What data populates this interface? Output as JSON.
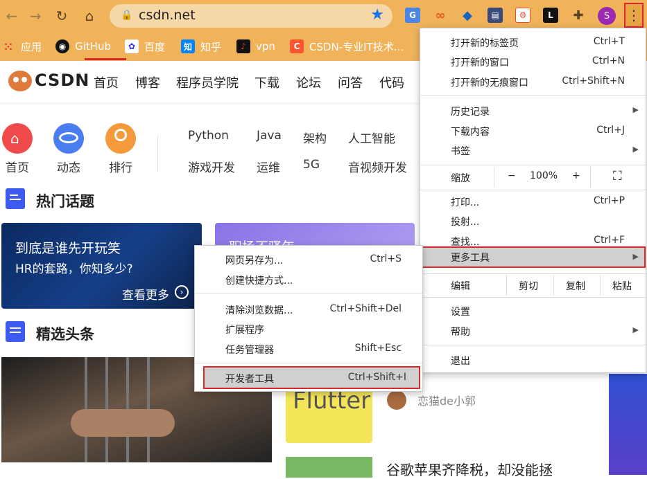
{
  "browser": {
    "url": "csdn.net",
    "profile_initial": "S",
    "bookmarks": [
      {
        "label": "应用",
        "icon": "apps-grid-icon"
      },
      {
        "label": "GitHub",
        "icon": "github-icon"
      },
      {
        "label": "百度",
        "icon": "baidu-paw-icon"
      },
      {
        "label": "知乎",
        "icon": "zhihu-icon"
      },
      {
        "label": "vpn",
        "icon": "vpn-icon"
      },
      {
        "label": "CSDN-专业IT技术...",
        "icon": "csdn-icon"
      }
    ]
  },
  "csdn": {
    "logo_text": "CSDN",
    "nav": [
      "首页",
      "博客",
      "程序员学院",
      "下载",
      "论坛",
      "问答",
      "代码"
    ],
    "quick_links": [
      "首页",
      "动态",
      "排行"
    ],
    "tags_row1": [
      "Python",
      "Java",
      "架构",
      "人工智能"
    ],
    "tags_row2": [
      "游戏开发",
      "运维",
      "5G",
      "音视频开发"
    ],
    "hot_topics_title": "热门话题",
    "banner1_title": "到底是谁先开玩笑",
    "banner1_sub": "HR的套路，你知多少?",
    "banner1_more": "查看更多",
    "banner2_title": "职场不骚年",
    "featured_title": "精选头条",
    "flutter_text": "Flutter",
    "article_author": "恋猫de小郭",
    "article_title": "谷歌苹果齐降税，却没能拯"
  },
  "chrome_menu": {
    "new_tab": "打开新的标签页",
    "new_tab_sc": "Ctrl+T",
    "new_window": "打开新的窗口",
    "new_window_sc": "Ctrl+N",
    "incognito": "打开新的无痕窗口",
    "incognito_sc": "Ctrl+Shift+N",
    "history": "历史记录",
    "downloads": "下载内容",
    "downloads_sc": "Ctrl+J",
    "bookmarks": "书签",
    "zoom": "缩放",
    "zoom_minus": "−",
    "zoom_level": "100%",
    "zoom_plus": "+",
    "print": "打印...",
    "print_sc": "Ctrl+P",
    "cast": "投射...",
    "find": "查找...",
    "find_sc": "Ctrl+F",
    "more_tools": "更多工具",
    "edit": "编辑",
    "cut": "剪切",
    "copy": "复制",
    "paste": "粘贴",
    "settings": "设置",
    "help": "帮助",
    "exit": "退出"
  },
  "more_tools_menu": {
    "save_page": "网页另存为...",
    "save_page_sc": "Ctrl+S",
    "create_shortcut": "创建快捷方式...",
    "clear_data": "清除浏览数据...",
    "clear_data_sc": "Ctrl+Shift+Del",
    "extensions": "扩展程序",
    "task_manager": "任务管理器",
    "task_manager_sc": "Shift+Esc",
    "dev_tools": "开发者工具",
    "dev_tools_sc": "Ctrl+Shift+I"
  },
  "colors": {
    "accent": "#1a73e8",
    "highlight": "#d9272e",
    "csdn_red": "#fc5531"
  }
}
